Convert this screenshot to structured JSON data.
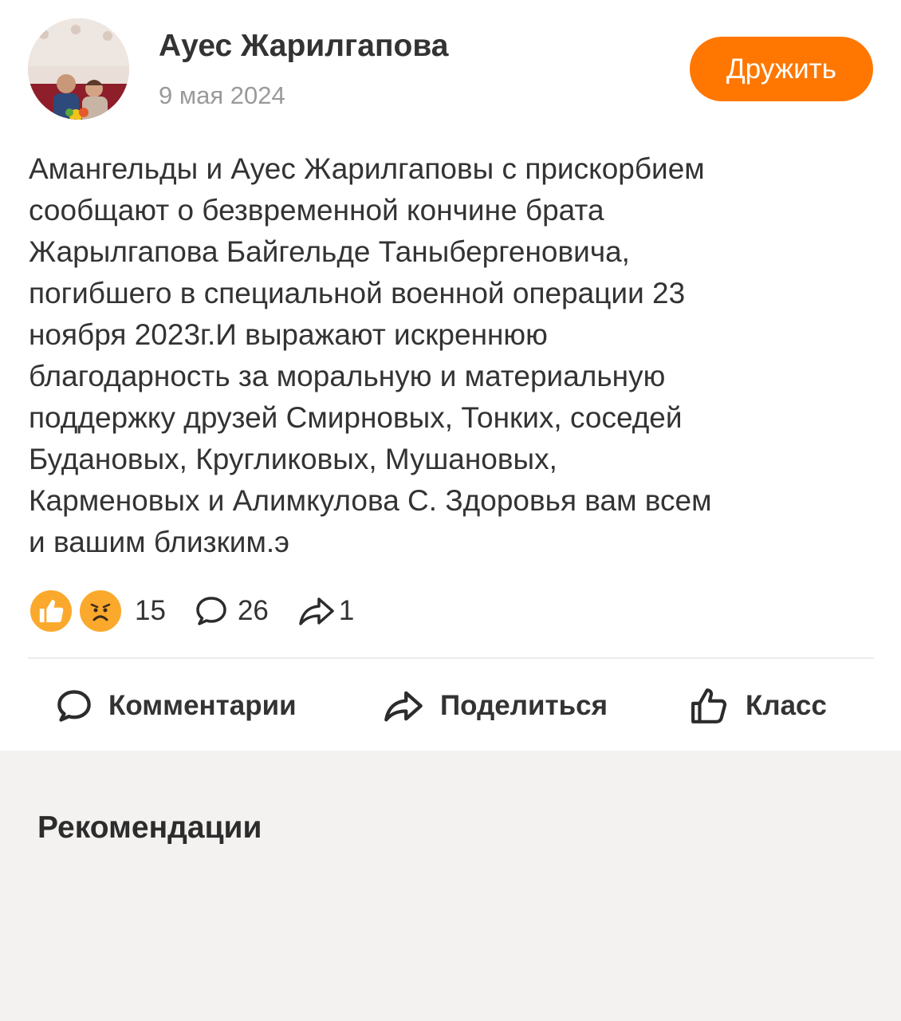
{
  "post": {
    "author": "Ауес Жарилгапова",
    "date": "9 мая 2024",
    "friend_button": "Дружить",
    "text_lines": [
      "Амангельды и Ауес Жарилгаповы с прискорбием",
      "сообщают о безвременной кончине брата",
      "Жарылгапова Байгельде Таныбергеновича,",
      "погибшего в специальной военной операции 23",
      "ноября 2023г.И выражают искреннюю",
      "благодарность за моральную и материальную",
      "поддержку друзей Смирновых, Тонких, соседей",
      "Будановых, Кругликовых, Мушановых,",
      "Карменовых и Алимкулова С. Здоровья вам всем",
      "и вашим близким.э"
    ],
    "stats": {
      "reactions": [
        "like-reaction-icon",
        "sad-reaction-icon"
      ],
      "reactions_count": "15",
      "comments_count": "26",
      "shares_count": "1"
    },
    "actions": {
      "comments": "Комментарии",
      "share": "Поделиться",
      "like": "Класс"
    }
  },
  "recommendations": {
    "title": "Рекомендации"
  },
  "colors": {
    "accent": "#ff7700",
    "reaction": "#fba92c",
    "background": "#f3f2f0"
  }
}
